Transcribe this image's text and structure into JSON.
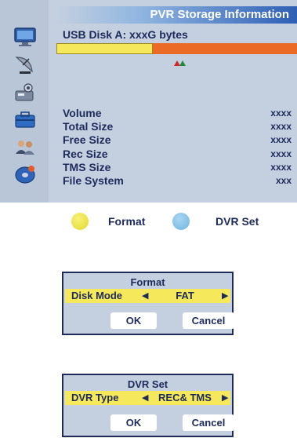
{
  "panel": {
    "title": "PVR Storage Information",
    "disk_label": "USB Disk A: xxxG bytes",
    "storage_used_fraction": 0.4,
    "sidebar_icons": [
      "monitor-icon",
      "satellite-dish-icon",
      "settings-tools-icon",
      "toolbox-icon",
      "users-icon",
      "disk-record-icon"
    ],
    "rows": [
      {
        "label": "Volume",
        "value": "xxxx"
      },
      {
        "label": "Total Size",
        "value": "xxxx"
      },
      {
        "label": "Free Size",
        "value": "xxxx"
      },
      {
        "label": "Rec Size",
        "value": "xxxx"
      },
      {
        "label": "TMS Size",
        "value": "xxxx"
      },
      {
        "label": "File System",
        "value": "xxx"
      }
    ]
  },
  "legend": {
    "format_label": "Format",
    "dvr_set_label": "DVR Set"
  },
  "format_dialog": {
    "title": "Format",
    "field_label": "Disk Mode",
    "field_value": "FAT",
    "ok_label": "OK",
    "cancel_label": "Cancel"
  },
  "dvr_dialog": {
    "title": "DVR Set",
    "field_label": "DVR Type",
    "field_value": "REC& TMS",
    "ok_label": "OK",
    "cancel_label": "Cancel"
  },
  "colors": {
    "highlight": "#f5e85a",
    "free_bar": "#ea6a26",
    "panel_bg": "#c4d0e0",
    "title_blue": "#2e5fb5",
    "text": "#1e2a5a",
    "yellow_key": "#e2d82a",
    "blue_key": "#6fb3e0"
  }
}
